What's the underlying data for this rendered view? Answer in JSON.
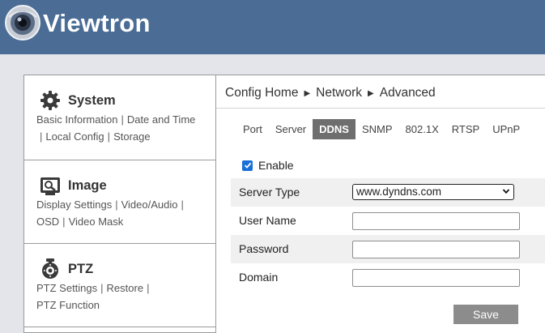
{
  "header": {
    "brand": "Viewtron",
    "logo_icon": "viewtron-camera-logo",
    "background_color": "#4a6c95"
  },
  "sidebar": {
    "sections": [
      {
        "title": "System",
        "icon": "gear-icon",
        "links": [
          "Basic Information",
          "Date and Time",
          "Local Config",
          "Storage"
        ]
      },
      {
        "title": "Image",
        "icon": "image-settings-icon",
        "links": [
          "Display Settings",
          "Video/Audio",
          "OSD",
          "Video Mask"
        ]
      },
      {
        "title": "PTZ",
        "icon": "ptz-camera-icon",
        "links": [
          "PTZ Settings",
          "Restore",
          "PTZ Function"
        ]
      }
    ],
    "separator": "|"
  },
  "breadcrumb": {
    "items": [
      "Config Home",
      "Network",
      "Advanced"
    ],
    "arrow": "▶"
  },
  "tabs": {
    "items": [
      "Port",
      "Server",
      "DDNS",
      "SNMP",
      "802.1X",
      "RTSP",
      "UPnP"
    ],
    "active": "DDNS",
    "active_color": "#6e6e6e"
  },
  "form": {
    "enable_label": "Enable",
    "enable_checked": true,
    "server_type_label": "Server Type",
    "server_type_value": "www.dyndns.com",
    "user_name_label": "User Name",
    "user_name_value": "",
    "password_label": "Password",
    "password_value": "",
    "domain_label": "Domain",
    "domain_value": "",
    "checkbox_color": "#1a6ed8"
  },
  "save_label": "Save"
}
